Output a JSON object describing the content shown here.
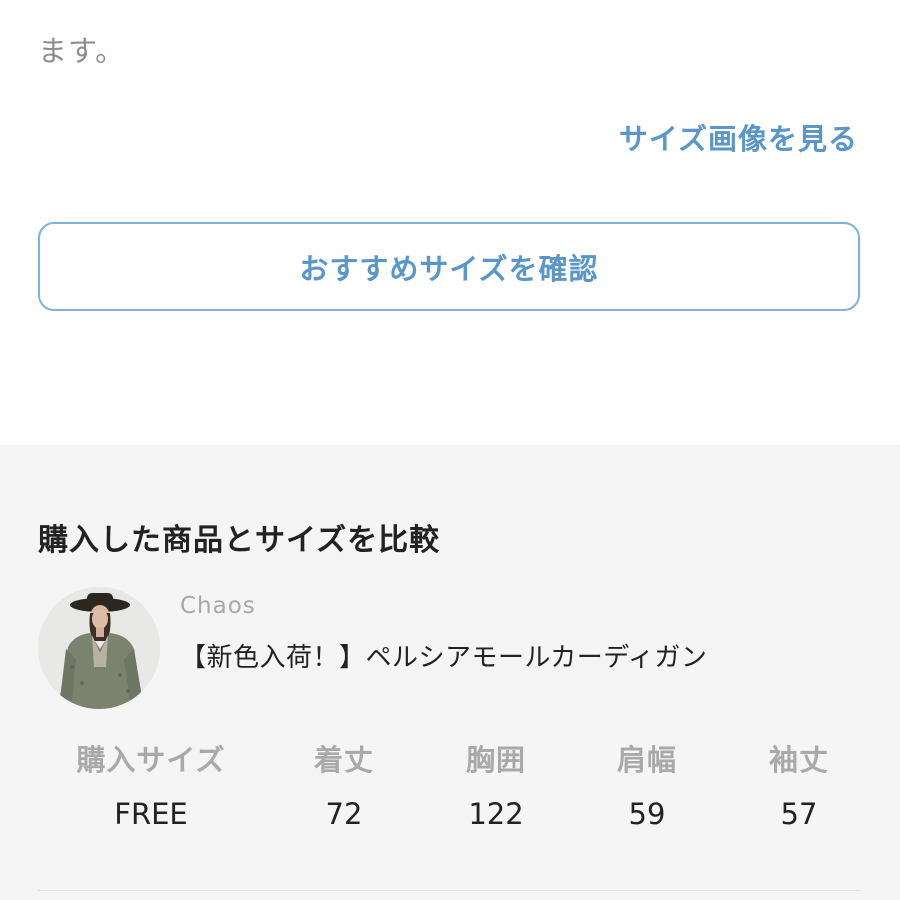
{
  "top": {
    "text": "ます。"
  },
  "size_image_link": "サイズ画像を見る",
  "recommend_button": "おすすめサイズを確認",
  "compare": {
    "title": "購入した商品とサイズを比較",
    "brand": "Chaos",
    "product_name": "【新色入荷！】ペルシアモールカーディガン",
    "avatar_icon": "product-model-photo",
    "table": {
      "headers": [
        "購入サイズ",
        "着丈",
        "胸囲",
        "肩幅",
        "袖丈"
      ],
      "values": [
        "FREE",
        "72",
        "122",
        "59",
        "57"
      ]
    }
  },
  "colors": {
    "accent": "#5a96c9",
    "button_border": "#7bb3dc",
    "section_bg": "#f5f5f5"
  }
}
